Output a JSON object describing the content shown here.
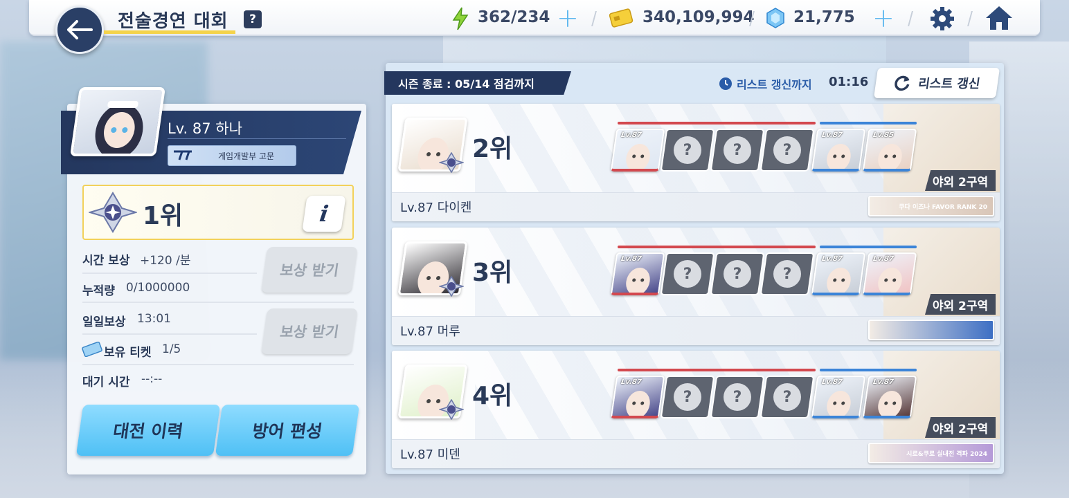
{
  "header": {
    "title": "전술경연 대회",
    "help": "?",
    "ap": "362/234",
    "credits": "340,109,994",
    "pyroxene": "21,775",
    "plus": "+"
  },
  "player": {
    "name": "Lv. 87  하나",
    "club": "게임개발부 고문",
    "rank": "1위",
    "info": "i",
    "time_reward_label": "시간 보상",
    "time_reward_value": "+120 /분",
    "accumulated_label": "누적량",
    "accumulated_value": "0/1000000",
    "daily_reward_label": "일일보상",
    "daily_reward_value": "13:01",
    "ticket_label": "보유 티켓",
    "ticket_value": "1/5",
    "wait_label": "대기 시간",
    "wait_value": "--:--",
    "claim_label": "보상 받기",
    "history_button": "대전 이력",
    "defense_button": "방어 편성"
  },
  "list": {
    "season_end": "시즌 종료 : 05/14 점검까지",
    "refresh_label": "리스트 갱신까지",
    "refresh_time": "01:16",
    "refresh_button": "리스트 갱신",
    "empty_slot": "?",
    "opponents": [
      {
        "rank": "2위",
        "name": "Lv.87  다이켄",
        "zone": "야외 2구역",
        "banner": "쿠다 이즈나 FAVOR RANK 20",
        "slots": [
          {
            "type": "char",
            "team": "red",
            "lv": "Lv.87",
            "color": "#dfe7f2"
          },
          {
            "type": "empty"
          },
          {
            "type": "empty"
          },
          {
            "type": "empty"
          },
          {
            "type": "char",
            "team": "blue",
            "lv": "Lv.87",
            "color": "#c9cfd8"
          },
          {
            "type": "char",
            "team": "blue",
            "lv": "Lv.85",
            "color": "#e9d2c4"
          }
        ],
        "avatar_color": "#e9dccd",
        "banner_color": "#d9c6b8"
      },
      {
        "rank": "3위",
        "name": "Lv.87  머루",
        "zone": "야외 2구역",
        "banner": "",
        "slots": [
          {
            "type": "char",
            "team": "red",
            "lv": "Lv.87",
            "color": "#4a4a8c"
          },
          {
            "type": "empty"
          },
          {
            "type": "empty"
          },
          {
            "type": "empty"
          },
          {
            "type": "char",
            "team": "blue",
            "lv": "Lv.87",
            "color": "#c9cfd8"
          },
          {
            "type": "char",
            "team": "blue",
            "lv": "Lv.87",
            "color": "#f0c4c4"
          }
        ],
        "avatar_color": "#2d2a30",
        "banner_color": "#3d6fc4"
      },
      {
        "rank": "4위",
        "name": "Lv.87  미덴",
        "zone": "야외 2구역",
        "banner": "시로&쿠로 실내전 격파 2024",
        "slots": [
          {
            "type": "char",
            "team": "red",
            "lv": "Lv.87",
            "color": "#4a4a8c"
          },
          {
            "type": "empty"
          },
          {
            "type": "empty"
          },
          {
            "type": "empty"
          },
          {
            "type": "char",
            "team": "blue",
            "lv": "Lv.87",
            "color": "#c9cfd8"
          },
          {
            "type": "char",
            "team": "blue",
            "lv": "Lv.87",
            "color": "#5a3c3c"
          }
        ],
        "avatar_color": "#dff0c9",
        "banner_color": "#b59ad8"
      }
    ]
  },
  "colors": {
    "navy": "#24375e",
    "accent_blue": "#4fc0f5",
    "red_team": "#d3484e",
    "blue_team": "#3b84d8",
    "gold": "#f2d15a"
  }
}
